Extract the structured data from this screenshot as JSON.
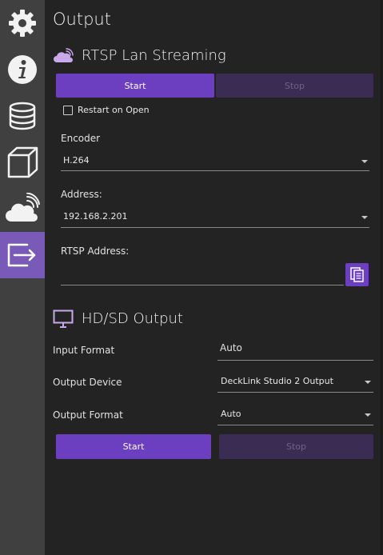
{
  "sidebar": {
    "items": [
      {
        "icon": "gear-icon"
      },
      {
        "icon": "info-icon"
      },
      {
        "icon": "database-icon"
      },
      {
        "icon": "cube-icon"
      },
      {
        "icon": "cloud-wifi-icon"
      },
      {
        "icon": "output-icon",
        "active": true
      }
    ]
  },
  "page": {
    "title": "Output"
  },
  "rtsp": {
    "title": "RTSP Lan Streaming",
    "start_label": "Start",
    "stop_label": "Stop",
    "restart_label": "Restart on Open",
    "restart_checked": false,
    "encoder_label": "Encoder",
    "encoder_value": "H.264",
    "address_label": "Address:",
    "address_value": "192.168.2.201",
    "rtsp_address_label": "RTSP Address:",
    "rtsp_address_value": ""
  },
  "hdsd": {
    "title": "HD/SD Output",
    "input_format_label": "Input Format",
    "input_format_value": "Auto",
    "output_device_label": "Output Device",
    "output_device_value": "DeckLink Studio 2 Output",
    "output_format_label": "Output Format",
    "output_format_value": "Auto",
    "start_label": "Start",
    "stop_label": "Stop"
  },
  "colors": {
    "accent": "#6b3fc0",
    "accent_disabled": "#3a2c52",
    "sidebar_active": "#7a5ab8",
    "background": "#232323",
    "sidebar": "#404040"
  }
}
